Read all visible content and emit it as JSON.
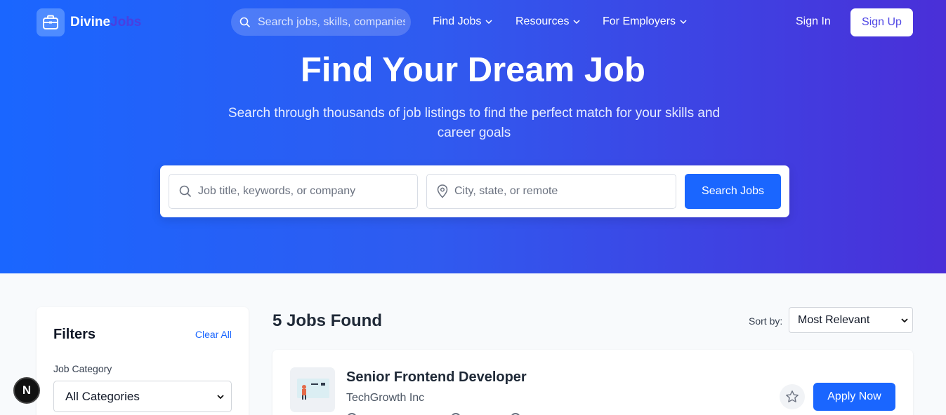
{
  "brand": {
    "name": "Divine",
    "name_accent": "Jobs"
  },
  "nav": {
    "search_placeholder": "Search jobs, skills, companies",
    "links": [
      {
        "label": "Find Jobs"
      },
      {
        "label": "Resources"
      },
      {
        "label": "For Employers"
      }
    ],
    "sign_in": "Sign In",
    "sign_up": "Sign Up"
  },
  "hero": {
    "title": "Find Your Dream Job",
    "subtitle": "Search through thousands of job listings to find the perfect match for your skills and career goals",
    "keyword_placeholder": "Job title, keywords, or company",
    "location_placeholder": "City, state, or remote",
    "search_button": "Search Jobs"
  },
  "filters": {
    "title": "Filters",
    "clear_all": "Clear All",
    "category_label": "Job Category",
    "category_value": "All Categories"
  },
  "results": {
    "count_label": "5 Jobs Found",
    "sort_label": "Sort by:",
    "sort_value": "Most Relevant",
    "jobs": [
      {
        "title": "Senior Frontend Developer",
        "company": "TechGrowth Inc",
        "apply_label": "Apply Now"
      }
    ]
  },
  "dev_badge": "N",
  "colors": {
    "primary": "#1a66ff",
    "hero_end": "#4a2fd8",
    "accent_text": "#4f46e5"
  }
}
